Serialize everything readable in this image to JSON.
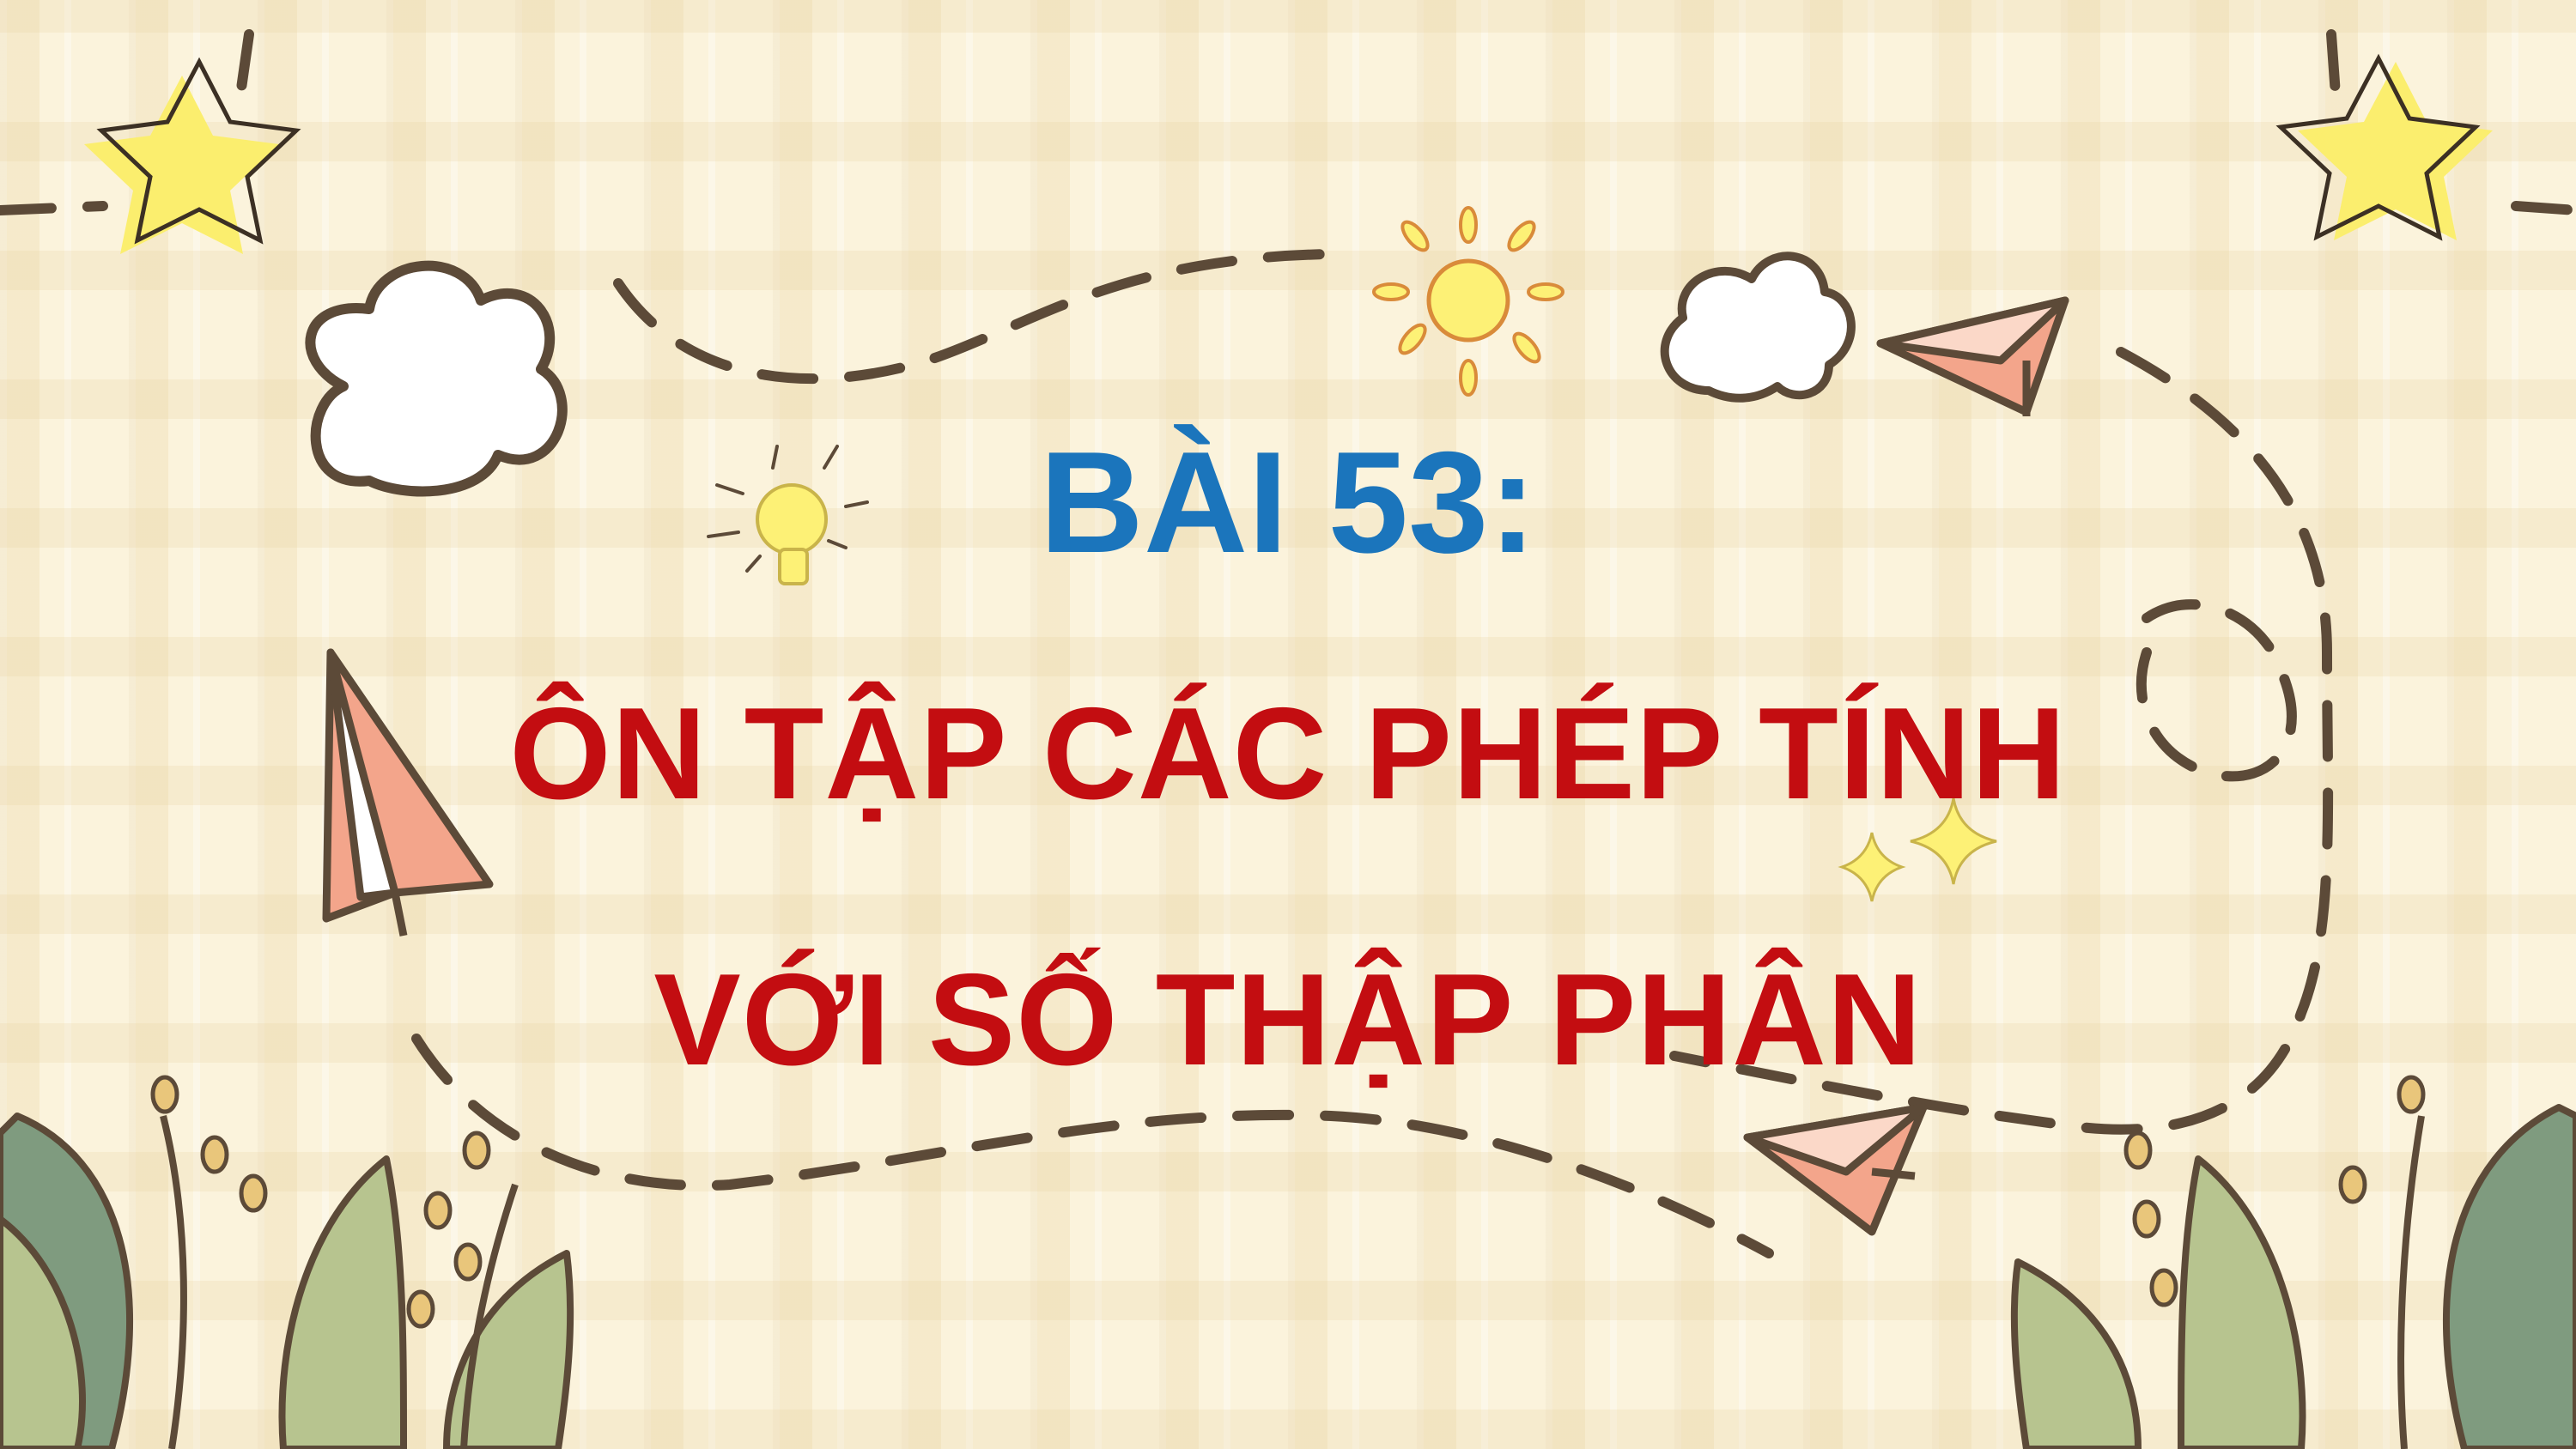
{
  "slide": {
    "lesson_label": "BÀI 53:",
    "title_line_1": "ÔN TẬP CÁC PHÉP TÍNH",
    "title_line_2": "VỚI SỐ THẬP PHÂN"
  },
  "colors": {
    "background": "#fbf3dc",
    "lesson_label": "#1b75bc",
    "title": "#c30d11",
    "dashed_path": "#5c4a38",
    "star_fill": "#fbee6e",
    "sun_fill": "#fdf176",
    "paper_plane_fill": "#f3a58b",
    "leaf_green": "#b7c48f",
    "leaf_dark_green": "#7f9b7f",
    "berry": "#e9c67b"
  },
  "decorations": [
    "star-icon",
    "cloud-icon",
    "sun-icon",
    "lightbulb-icon",
    "paper-plane-icon",
    "sparkle-icon",
    "leaf-icon",
    "dashed-path"
  ]
}
